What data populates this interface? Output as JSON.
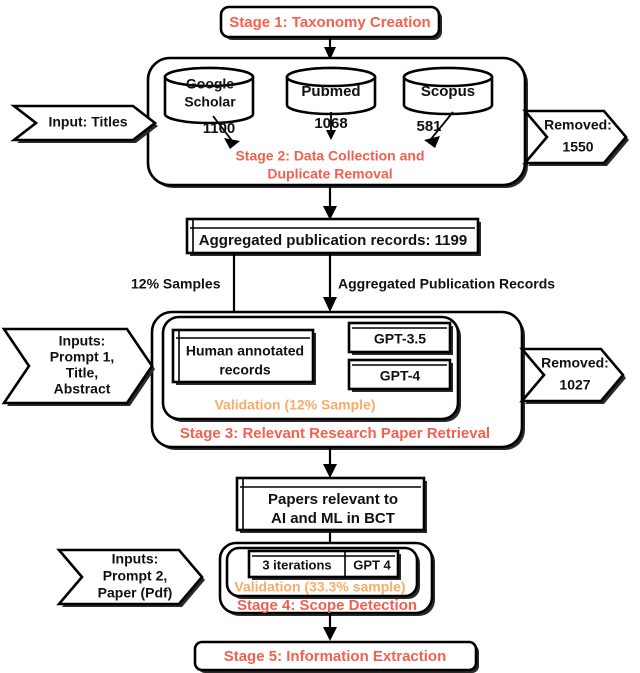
{
  "diagram": {
    "title": "Research methodology pipeline flowchart",
    "colors": {
      "stage_label": "#f4604f",
      "validation_label": "#fbab67",
      "text": "#111111",
      "stroke": "#000000",
      "background": "#ffffff"
    }
  },
  "stages": {
    "stage1": "Stage 1: Taxonomy Creation",
    "stage2_line1": "Stage 2: Data Collection and",
    "stage2_line2": "Duplicate Removal",
    "stage3": "Stage 3: Relevant Research Paper Retrieval",
    "stage4": "Stage 4: Scope Detection",
    "stage5": "Stage 5: Information Extraction"
  },
  "databases": [
    {
      "name_line1": "Google",
      "name_line2": "Scholar",
      "count": "1100"
    },
    {
      "name_line1": "Pubmed",
      "name_line2": "",
      "count": "1068"
    },
    {
      "name_line1": "Scopus",
      "name_line2": "",
      "count": "581"
    }
  ],
  "inputs": {
    "titles": "Input: Titles",
    "stage3_line1": "Inputs:",
    "stage3_line2": "Prompt 1,",
    "stage3_line3": "Title,",
    "stage3_line4": "Abstract",
    "stage4_line1": "Inputs:",
    "stage4_line2": "Prompt 2,",
    "stage4_line3": "Paper (Pdf)"
  },
  "removed": {
    "stage2_label": "Removed:",
    "stage2_count": "1550",
    "stage3_label": "Removed:",
    "stage3_count": "1027"
  },
  "records": {
    "aggregated": "Aggregated publication records: 1199",
    "relevant_line1": "Papers relevant to",
    "relevant_line2": "AI and ML in BCT"
  },
  "edge_labels": {
    "samples": "12% Samples",
    "aggregated": "Aggregated Publication Records"
  },
  "stage3_inner": {
    "human_line1": "Human annotated",
    "human_line2": "records",
    "model_1": "GPT-3.5",
    "model_2": "GPT-4",
    "validation": "Validation (12% Sample)"
  },
  "stage4_inner": {
    "iterations": "3 iterations",
    "model": "GPT 4",
    "validation": "Validation (33.3% sample)"
  }
}
